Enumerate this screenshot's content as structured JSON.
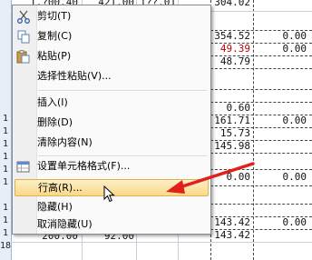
{
  "spreadsheet": {
    "row_numbers": [
      "1",
      "1",
      "1",
      "1",
      "1",
      "1",
      "1",
      "1",
      "1",
      "18"
    ],
    "top_partial_cells": [
      "1,?00.40",
      "421.00",
      "1??.01",
      "304.02"
    ],
    "rows": [
      {
        "c4": "354.52",
        "c5": "0.00",
        "c4_red": false
      },
      {
        "c4": "49.39",
        "c5": "0.00",
        "c4_red": true
      },
      {
        "c4": "48.79",
        "c5": "",
        "c4_red": false
      },
      {
        "c4": "",
        "c5": "",
        "c4_red": false
      },
      {
        "c4": "0.60",
        "c5": "",
        "c4_red": false
      },
      {
        "c4": "161.71",
        "c5": "0.00",
        "c4_red": false
      },
      {
        "c4": "15.73",
        "c5": "",
        "c4_red": false
      },
      {
        "c4": "145.98",
        "c5": "",
        "c4_red": false
      },
      {
        "c4": "",
        "c5": "",
        "c4_red": false
      },
      {
        "c4": "0.00",
        "c5": "0.00",
        "c4_red": false
      },
      {
        "c4": "",
        "c5": "",
        "c4_red": false
      },
      {
        "c4": "143.42",
        "c5": "0.00",
        "c4_red": false
      },
      {
        "c4": "143.42",
        "c5": "",
        "c4_red": false
      }
    ],
    "bottom_row": {
      "c1": "200.00",
      "c2": "92.00"
    }
  },
  "context_menu": {
    "items": [
      {
        "label": "剪切(T)",
        "icon": "scissors-icon"
      },
      {
        "label": "复制(C)",
        "icon": "copy-icon"
      },
      {
        "label": "粘贴(P)",
        "icon": "paste-icon"
      },
      {
        "label": "选择性粘贴(V)...",
        "icon": ""
      },
      {
        "label": "插入(I)",
        "icon": ""
      },
      {
        "label": "删除(D)",
        "icon": ""
      },
      {
        "label": "清除内容(N)",
        "icon": ""
      },
      {
        "label": "设置单元格格式(F)...",
        "icon": "format-cells-icon"
      },
      {
        "label": "行高(R)...",
        "icon": ""
      },
      {
        "label": "隐藏(H)",
        "icon": ""
      },
      {
        "label": "取消隐藏(U)",
        "icon": ""
      }
    ],
    "highlighted_item": "行高(R)...",
    "highlight_color": "#f9d88a"
  },
  "annotation": {
    "arrow_color": "#e0201b"
  }
}
